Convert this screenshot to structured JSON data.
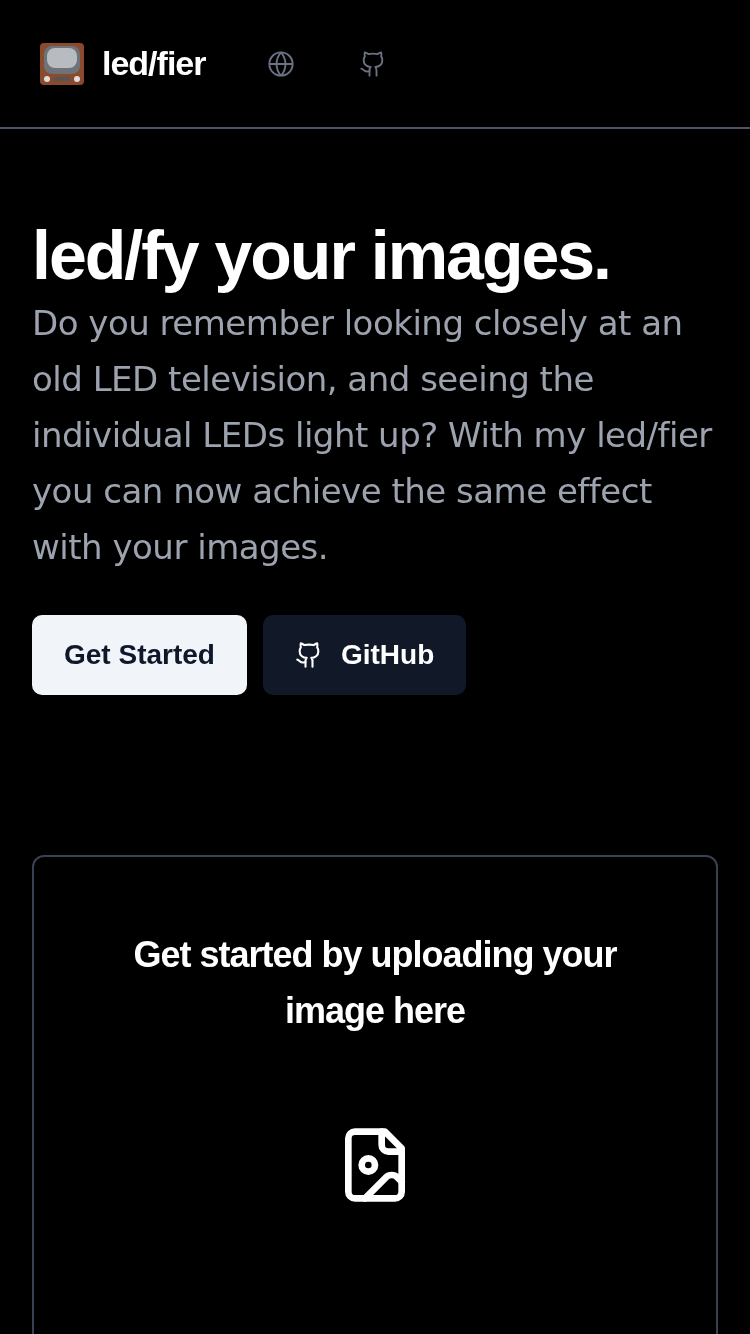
{
  "header": {
    "brand": "led/fier"
  },
  "hero": {
    "title": "led/fy your images.",
    "description": "Do you remember looking closely at an old LED television, and seeing the individual LEDs light up? With my led/fier you can now achieve the same effect with your images.",
    "buttons": [
      {
        "label": "Get Started",
        "kind": "primary"
      },
      {
        "label": "GitHub",
        "kind": "secondary"
      }
    ]
  },
  "upload": {
    "heading": "Get started by uploading your image here"
  }
}
